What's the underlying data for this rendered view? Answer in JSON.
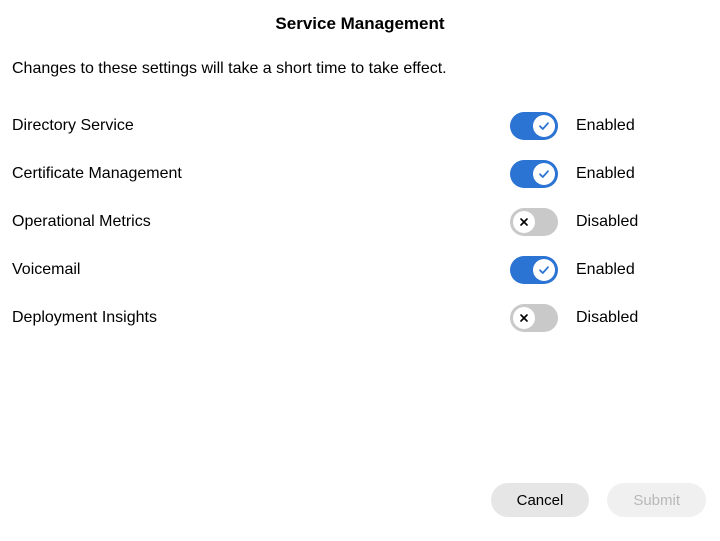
{
  "header": {
    "title": "Service Management"
  },
  "description": "Changes to these settings will take a short time to take effect.",
  "status_labels": {
    "on": "Enabled",
    "off": "Disabled"
  },
  "services": [
    {
      "label": "Directory Service",
      "enabled": true
    },
    {
      "label": "Certificate Management",
      "enabled": true
    },
    {
      "label": "Operational Metrics",
      "enabled": false
    },
    {
      "label": "Voicemail",
      "enabled": true
    },
    {
      "label": "Deployment Insights",
      "enabled": false
    }
  ],
  "footer": {
    "cancel_label": "Cancel",
    "submit_label": "Submit"
  },
  "icons": {
    "check": "check-icon",
    "cross": "cross-icon"
  }
}
